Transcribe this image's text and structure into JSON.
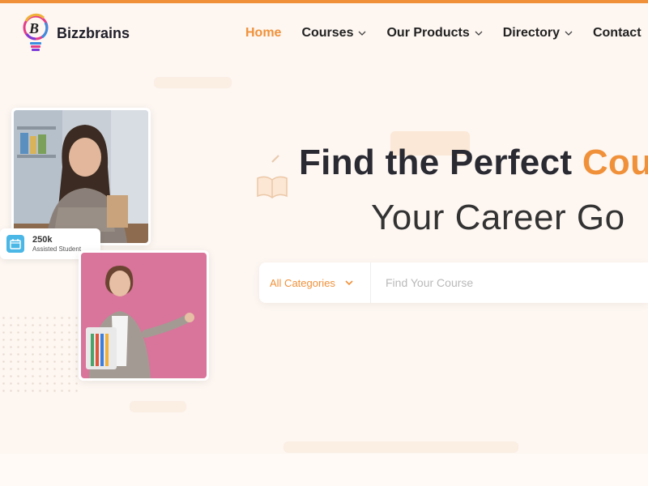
{
  "brand": {
    "name": "Bizzbrains",
    "accent": "#f0913a"
  },
  "nav": {
    "items": [
      {
        "label": "Home",
        "active": true
      },
      {
        "label": "Courses",
        "dropdown": true
      },
      {
        "label": "Our Products",
        "dropdown": true
      },
      {
        "label": "Directory",
        "dropdown": true
      },
      {
        "label": "Contact"
      }
    ]
  },
  "hero": {
    "title_part1": "Find the Perfect ",
    "title_accent": "Cou",
    "subtitle": "Your Career Go"
  },
  "stat": {
    "value": "250k",
    "label": "Assisted Student",
    "icon": "calendar-icon"
  },
  "search": {
    "category_label": "All Categories",
    "placeholder": "Find Your Course"
  },
  "icons": [
    "chevron-down-icon",
    "calendar-icon",
    "book-icon",
    "logo-icon"
  ]
}
